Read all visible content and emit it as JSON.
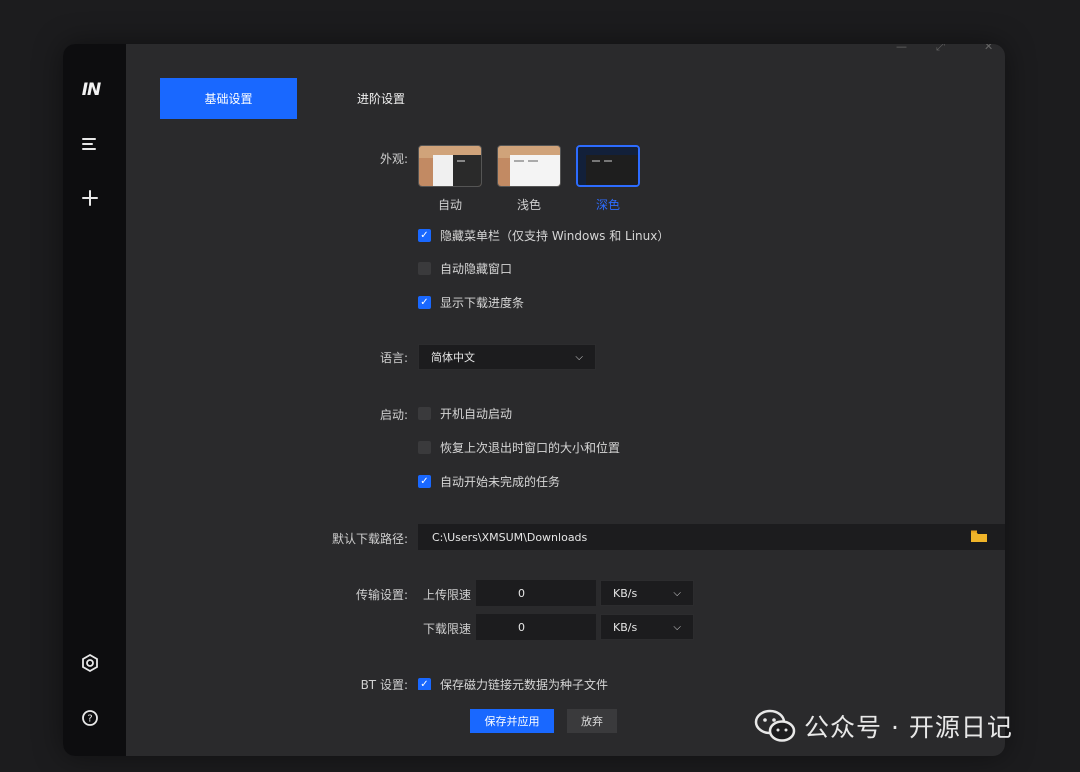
{
  "sidebar": {
    "logo": "IN",
    "icons": [
      "menu-icon",
      "plus-icon",
      "gear-icon",
      "help-icon"
    ]
  },
  "tabs": {
    "basic": "基础设置",
    "advanced": "进阶设置"
  },
  "appearance": {
    "label": "外观:",
    "options": [
      "自动",
      "浅色",
      "深色"
    ],
    "selected": "深色"
  },
  "checkboxes": {
    "hide_menu": {
      "text": "隐藏菜单栏（仅支持 Windows 和 Linux）",
      "checked": true
    },
    "auto_hide": {
      "text": "自动隐藏窗口",
      "checked": false
    },
    "show_progress": {
      "text": "显示下载进度条",
      "checked": true
    }
  },
  "language": {
    "label": "语言:",
    "value": "简体中文"
  },
  "startup": {
    "label": "启动:",
    "items": [
      {
        "text": "开机自动启动",
        "checked": false
      },
      {
        "text": "恢复上次退出时窗口的大小和位置",
        "checked": false
      },
      {
        "text": "自动开始未完成的任务",
        "checked": true
      }
    ]
  },
  "download_path": {
    "label": "默认下载路径:",
    "value": "C:\\Users\\XMSUM\\Downloads"
  },
  "transfer": {
    "label": "传输设置:",
    "upload_label": "上传限速",
    "upload_value": "0",
    "upload_unit": "KB/s",
    "download_label": "下载限速",
    "download_value": "0",
    "download_unit": "KB/s"
  },
  "bt": {
    "label": "BT 设置:",
    "text": "保存磁力链接元数据为种子文件",
    "checked": true
  },
  "actions": {
    "save": "保存并应用",
    "discard": "放弃"
  },
  "watermark": {
    "text": "公众号 · 开源日记"
  },
  "colors": {
    "accent": "#1968ff",
    "sidebar": "#0d0d0f",
    "panel": "#2a2a2c"
  }
}
